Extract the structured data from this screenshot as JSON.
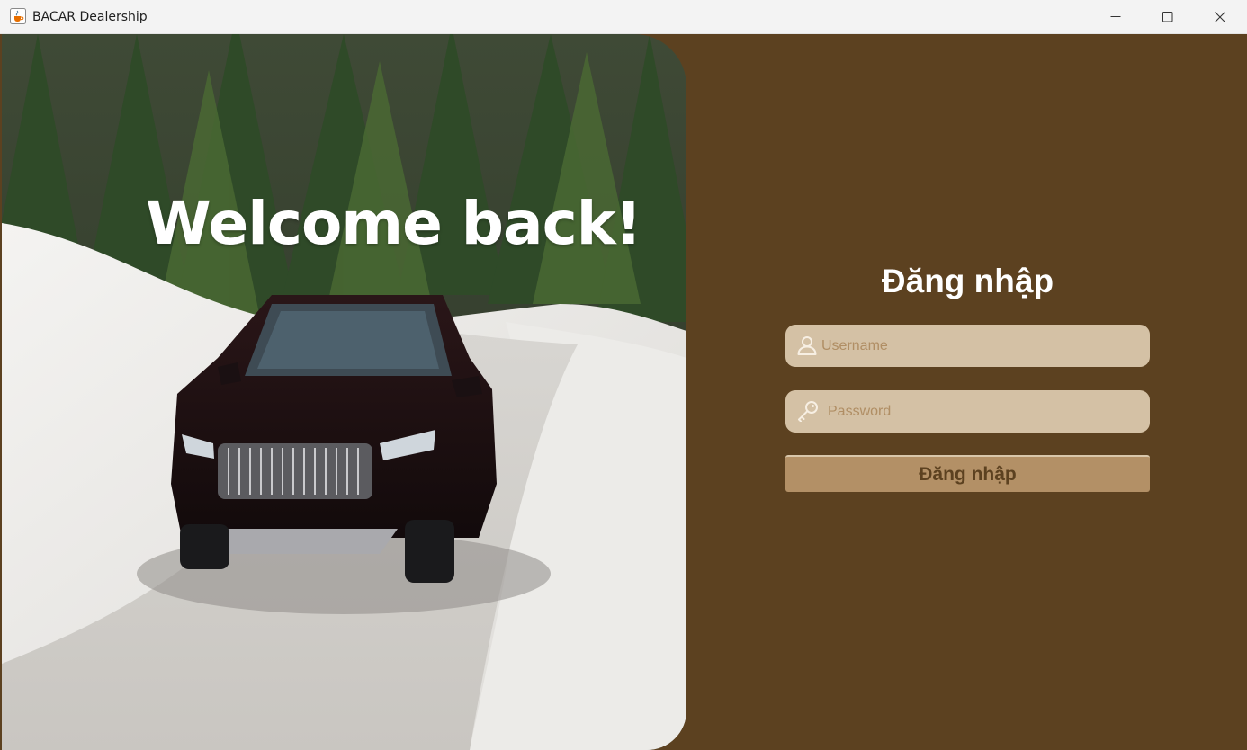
{
  "window": {
    "title": "BACAR Dealership",
    "icons": {
      "app": "java-cup-icon",
      "minimize": "minimize-icon",
      "maximize": "maximize-icon",
      "close": "close-icon"
    }
  },
  "hero": {
    "heading": "Welcome back!",
    "image_description_icon": "car-in-snow-image"
  },
  "login": {
    "title": "Đăng nhập",
    "username": {
      "placeholder": "Username",
      "value": "",
      "icon": "user-icon"
    },
    "password": {
      "placeholder": "Password",
      "value": "",
      "icon": "key-icon"
    },
    "submit_label": "Đăng nhập"
  },
  "colors": {
    "background": "#5c4120",
    "field": "#d4c1a5",
    "placeholder": "#b08e64",
    "button": "#b39066",
    "title_text": "#ffffff"
  }
}
